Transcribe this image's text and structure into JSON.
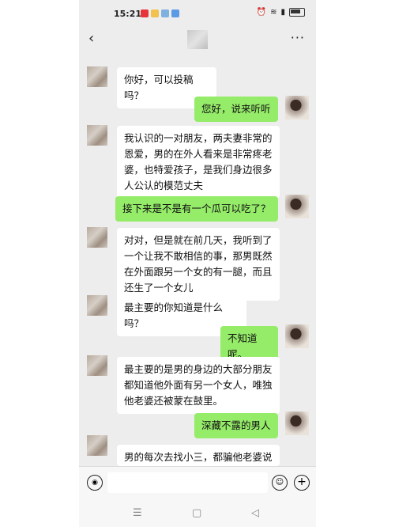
{
  "status_bar": {
    "time": "15:21",
    "app_icon_colors": [
      "#e8333a",
      "#f2c14e",
      "#7fb0e0",
      "#5b9be6"
    ],
    "right_text": "100"
  },
  "title_bar": {
    "back_icon": "chevron-left-icon",
    "more_icon": "ellipsis-icon",
    "more_text": "···",
    "back_text": "‹"
  },
  "messages": [
    {
      "side": "left",
      "text": "你好，可以投稿吗？"
    },
    {
      "side": "right",
      "text": "您好，说来听听"
    },
    {
      "side": "left",
      "text": "我认识的一对朋友，两夫妻非常的恩爱，男的在外人看来是非常疼老婆，也特爱孩子，是我们身边很多人公认的模范丈夫"
    },
    {
      "side": "right",
      "text": "接下来是不是有一个瓜可以吃了？"
    },
    {
      "side": "left",
      "text": "对对，但是就在前几天，我听到了一个让我不敢相信的事，那男既然在外面跟另一个女的有一腿，而且还生了一个女儿"
    },
    {
      "side": "left",
      "text": "最主要的你知道是什么吗？"
    },
    {
      "side": "right",
      "text": "不知道呢。"
    },
    {
      "side": "left",
      "text": "最主要的是男的身边的大部分朋友都知道他外面有另一个女人，唯独他老婆还被蒙在鼓里。"
    },
    {
      "side": "right",
      "text": "深藏不露的男人"
    },
    {
      "side": "left",
      "text": "男的每次去找小三，都骗他老婆说去朋友家打牌，而这帮狐朋狗友竟"
    }
  ],
  "input_bar": {
    "voice_icon": "voice-icon",
    "emoji_icon": "emoji-icon",
    "plus_icon": "plus-icon",
    "voice_glyph": "◉",
    "emoji_glyph": "☺",
    "plus_glyph": "+"
  },
  "nav_bar": {
    "menu_glyph": "☰",
    "home_glyph": "▢",
    "back_glyph": "◁"
  },
  "colors": {
    "chat_background": "#ededed",
    "bubble_left": "#ffffff",
    "bubble_right": "#95ec69"
  }
}
